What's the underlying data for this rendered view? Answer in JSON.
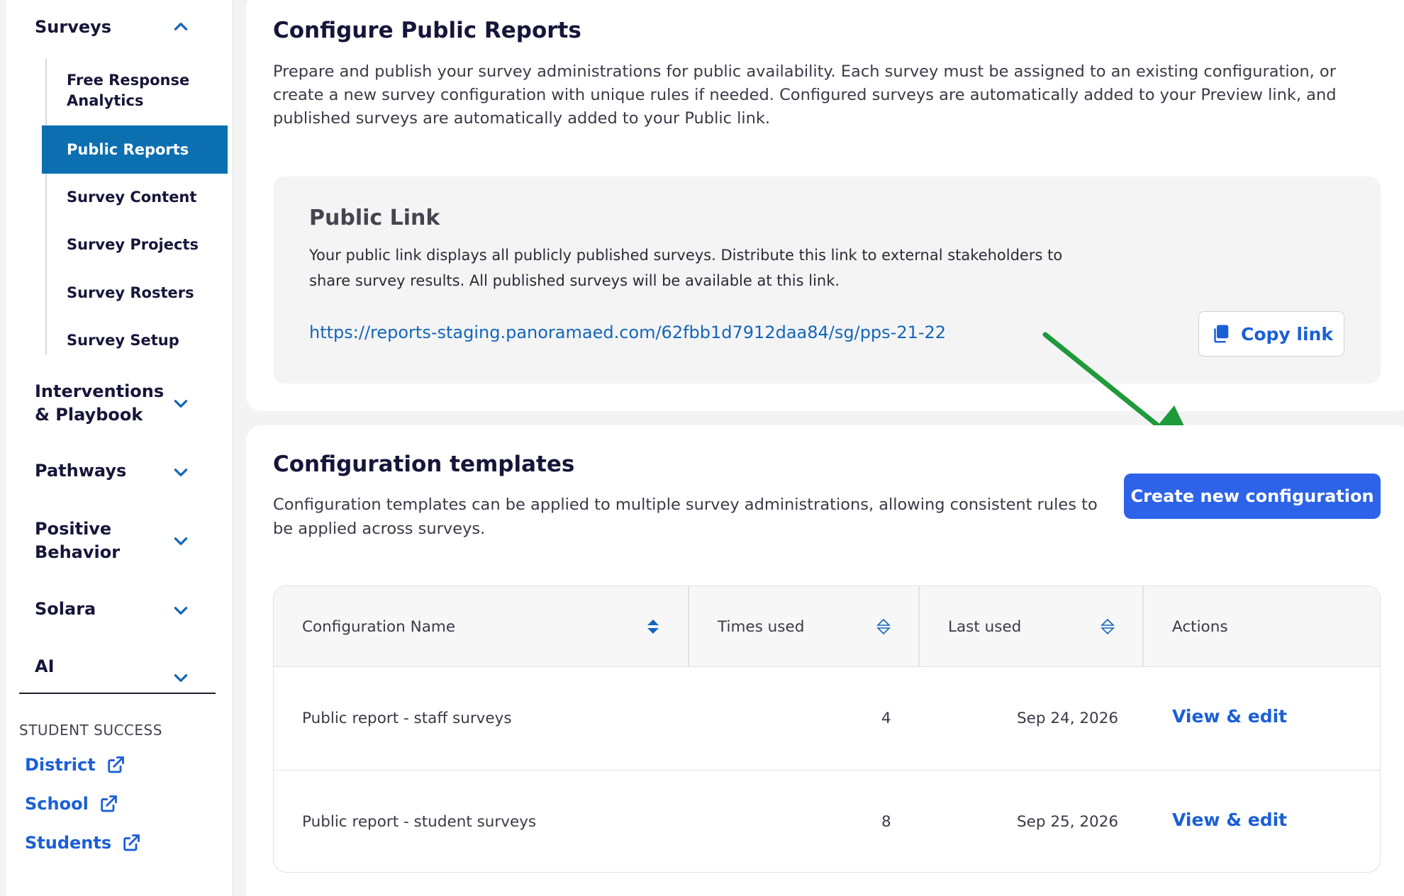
{
  "sidebar": {
    "top_items": [
      {
        "label": "Surveys",
        "expanded": true
      },
      {
        "label": "Interventions & Playbook",
        "expanded": false
      },
      {
        "label": "Pathways",
        "expanded": false
      },
      {
        "label": "Positive Behavior",
        "expanded": false
      },
      {
        "label": "Solara",
        "expanded": false
      },
      {
        "label": "AI",
        "expanded": false
      }
    ],
    "sub_items": [
      {
        "label": "Free Response Analytics"
      },
      {
        "label": "Public Reports",
        "active": true
      },
      {
        "label": "Survey Content"
      },
      {
        "label": "Survey Projects"
      },
      {
        "label": "Survey Rosters"
      },
      {
        "label": "Survey Setup"
      }
    ],
    "section_label": "STUDENT SUCCESS",
    "external_links": [
      "District",
      "School",
      "Students"
    ]
  },
  "page": {
    "title": "Configure Public Reports",
    "description": "Prepare and publish your survey administrations for public availability. Each survey must be assigned to an existing configuration, or create a new survey configuration with unique rules if needed. Configured surveys are automatically added to your Preview link, and published surveys are automatically added to your Public link."
  },
  "public_link": {
    "title": "Public Link",
    "description": "Your public link displays all publicly published surveys. Distribute this link to external stakeholders to share survey results. All published surveys will be available at this link.",
    "url": "https://reports-staging.panoramaed.com/62fbb1d7912daa84/sg/pps-21-22",
    "copy_label": "Copy link"
  },
  "config_templates": {
    "title": "Configuration templates",
    "description": "Configuration templates can be applied to multiple survey administrations, allowing consistent rules to be applied across surveys.",
    "create_label": "Create new configuration",
    "columns": [
      "Configuration Name",
      "Times used",
      "Last used",
      "Actions"
    ],
    "rows": [
      {
        "name": "Public report - staff surveys",
        "times_used": "4",
        "last_used": "Sep 24, 2026",
        "action": "View & edit"
      },
      {
        "name": "Public report - student surveys",
        "times_used": "8",
        "last_used": "Sep 25, 2026",
        "action": "View & edit"
      }
    ]
  },
  "colors": {
    "accent": "#0b6fb0",
    "link": "#1b5fd6",
    "primary_button": "#2d63e8",
    "annotation_arrow": "#1f9a3a"
  }
}
